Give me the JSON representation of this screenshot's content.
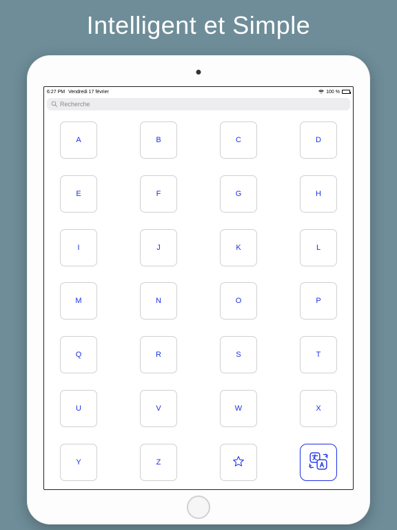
{
  "headline": "Intelligent et Simple",
  "status": {
    "time": "6:27 PM",
    "date": "Vendredi 17 février",
    "battery_text": "100 %"
  },
  "search": {
    "placeholder": "Recherche"
  },
  "grid": {
    "items": [
      "A",
      "B",
      "C",
      "D",
      "E",
      "F",
      "G",
      "H",
      "I",
      "J",
      "K",
      "L",
      "M",
      "N",
      "O",
      "P",
      "Q",
      "R",
      "S",
      "T",
      "U",
      "V",
      "W",
      "X",
      "Y",
      "Z"
    ]
  }
}
